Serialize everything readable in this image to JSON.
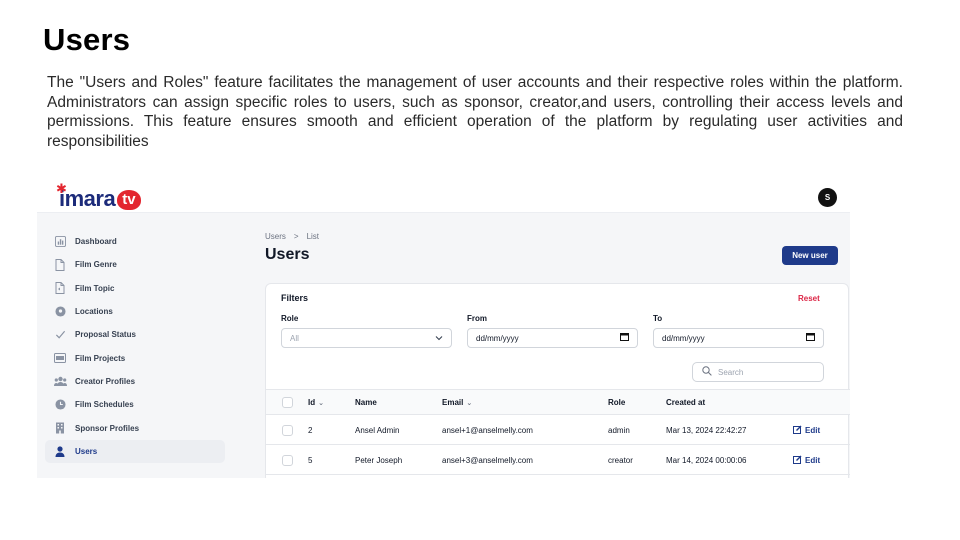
{
  "slide": {
    "title": "Users",
    "description": "The \"Users and Roles\" feature facilitates the management of user accounts and their respective roles within the platform. Administrators can assign specific roles to users, such as sponsor, creator,and users, controlling their access levels and permissions. This feature ensures smooth and efficient operation of the platform by regulating user activities and responsibilities"
  },
  "app": {
    "logo_text": "imara",
    "logo_tv": "tv",
    "avatar_initial": "S",
    "sidebar": {
      "items": [
        {
          "label": "Dashboard",
          "icon": "chart-icon"
        },
        {
          "label": "Film Genre",
          "icon": "document-icon"
        },
        {
          "label": "Film Topic",
          "icon": "document-icon"
        },
        {
          "label": "Locations",
          "icon": "location-pin-icon"
        },
        {
          "label": "Proposal Status",
          "icon": "check-icon"
        },
        {
          "label": "Film Projects",
          "icon": "film-icon"
        },
        {
          "label": "Creator Profiles",
          "icon": "users-group-icon"
        },
        {
          "label": "Film Schedules",
          "icon": "clock-icon"
        },
        {
          "label": "Sponsor Profiles",
          "icon": "building-icon"
        },
        {
          "label": "Users",
          "icon": "user-icon",
          "active": true
        }
      ]
    },
    "breadcrumb": {
      "first": "Users",
      "separator": ">",
      "second": "List"
    },
    "page_title": "Users",
    "new_user_label": "New user",
    "filters": {
      "title": "Filters",
      "reset_label": "Reset",
      "role_label": "Role",
      "role_value": "All",
      "from_label": "From",
      "from_value": "dd/mm/yyyy",
      "to_label": "To",
      "to_value": "dd/mm/yyyy"
    },
    "search_placeholder": "Search",
    "table": {
      "columns": {
        "id": "Id",
        "name": "Name",
        "email": "Email",
        "role": "Role",
        "created": "Created at"
      },
      "edit_label": "Edit",
      "rows": [
        {
          "id": "2",
          "name": "Ansel Admin",
          "email": "ansel+1@anselmelly.com",
          "role": "admin",
          "created": "Mar 13, 2024 22:42:27"
        },
        {
          "id": "5",
          "name": "Peter Joseph",
          "email": "ansel+3@anselmelly.com",
          "role": "creator",
          "created": "Mar 14, 2024 00:00:06"
        }
      ]
    },
    "colors": {
      "primary": "#1e3a8a",
      "reset": "#dc2646",
      "brand_red": "#e3262f"
    }
  }
}
